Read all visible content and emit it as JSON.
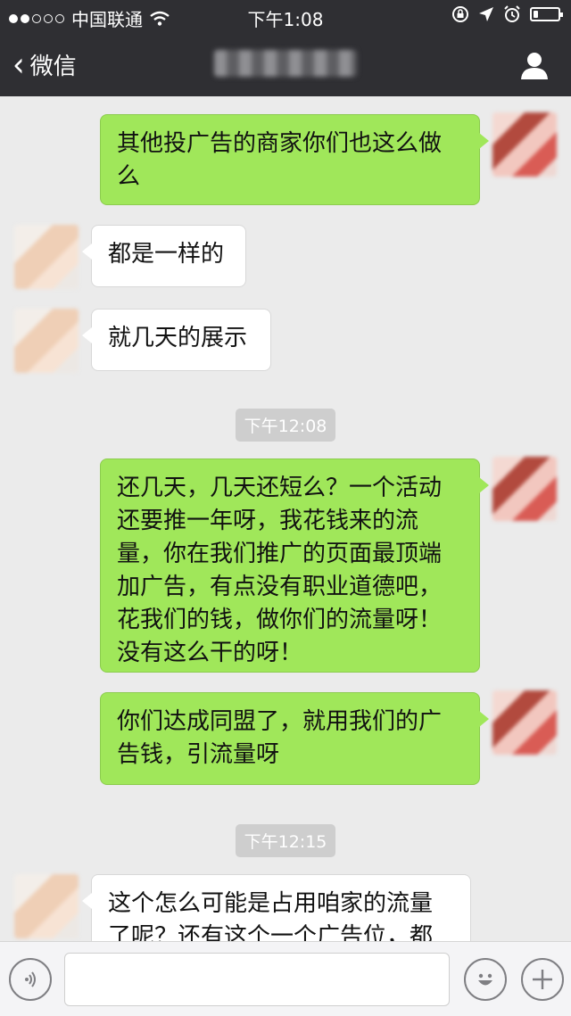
{
  "status_bar": {
    "carrier": "中国联通",
    "time": "下午1:08",
    "signal_dots": [
      true,
      true,
      false,
      false,
      false
    ],
    "battery_level": 0.2
  },
  "nav": {
    "back_label": "微信",
    "title_blurred": true
  },
  "messages": [
    {
      "type": "message",
      "side": "me",
      "text": "其他投广告的商家你们也这么做么"
    },
    {
      "type": "message",
      "side": "them",
      "text": "都是一样的"
    },
    {
      "type": "message",
      "side": "them",
      "text": "就几天的展示"
    },
    {
      "type": "time",
      "text": "下午12:08"
    },
    {
      "type": "message",
      "side": "me",
      "text": "还几天，几天还短么？一个活动还要推一年呀，我花钱来的流量，你在我们推广的页面最顶端加广告，有点没有职业道德吧，花我们的钱，做你们的流量呀！没有这么干的呀！"
    },
    {
      "type": "message",
      "side": "me",
      "text": "你们达成同盟了，就用我们的广告钱，引流量呀"
    },
    {
      "type": "time",
      "text": "下午12:15"
    },
    {
      "type": "message",
      "side": "them",
      "text": "这个怎么可能是占用咱家的流量了呢？还有这个一个广告位，都"
    }
  ],
  "input_bar": {
    "input_value": "",
    "icons": [
      "voice-icon",
      "emoji-icon",
      "plus-icon"
    ]
  },
  "colors": {
    "header_bg": "#2f2f33",
    "chat_bg": "#ebebeb",
    "my_bubble": "#a0e75a",
    "their_bubble": "#ffffff"
  }
}
